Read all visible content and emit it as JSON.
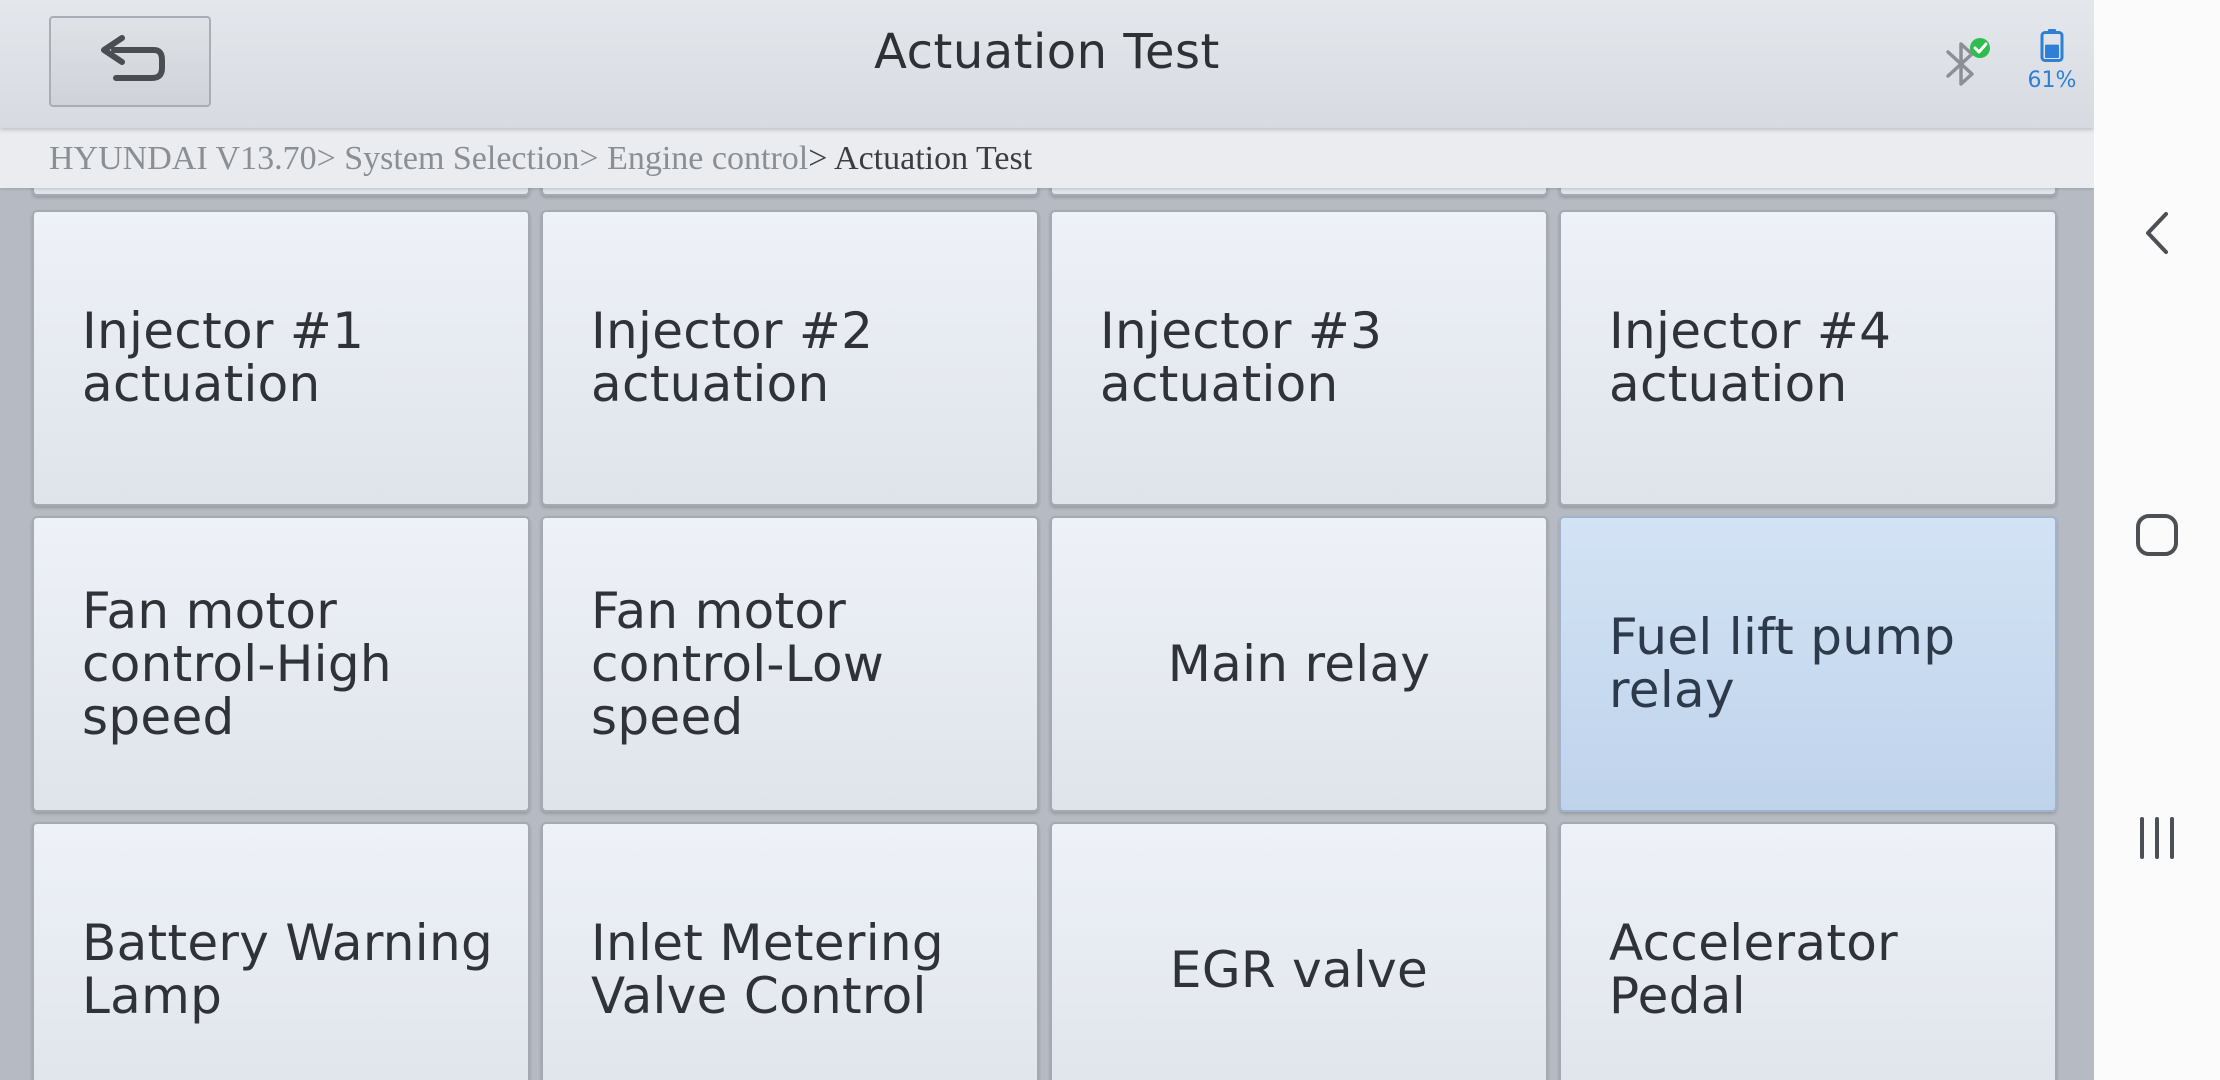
{
  "header": {
    "title": "Actuation Test",
    "back_icon": "back-arrow-icon",
    "bluetooth_icon": "bluetooth-connected-icon",
    "battery_icon": "battery-icon",
    "battery_percent": "61%",
    "battery_level": 0.61,
    "accent_color": "#2f7fd6",
    "connected_color": "#2ebd4e"
  },
  "breadcrumb": {
    "items": [
      "HYUNDAI V13.70",
      "> System Selection",
      "> Engine control",
      "> Actuation Test"
    ]
  },
  "tiles": [
    {
      "label": "Injector #1\nactuation",
      "selected": false,
      "centered": false
    },
    {
      "label": "Injector #2\nactuation",
      "selected": false,
      "centered": false
    },
    {
      "label": "Injector #3\nactuation",
      "selected": false,
      "centered": false
    },
    {
      "label": "Injector #4\nactuation",
      "selected": false,
      "centered": false
    },
    {
      "label": "Fan motor\ncontrol-High\nspeed",
      "selected": false,
      "centered": false
    },
    {
      "label": "Fan motor\ncontrol-Low\nspeed",
      "selected": false,
      "centered": false
    },
    {
      "label": "Main relay",
      "selected": false,
      "centered": true
    },
    {
      "label": "Fuel lift pump\nrelay",
      "selected": true,
      "centered": false
    },
    {
      "label": "Battery Warning\nLamp",
      "selected": false,
      "centered": false
    },
    {
      "label": "Inlet Metering\nValve Control",
      "selected": false,
      "centered": false
    },
    {
      "label": "EGR valve",
      "selected": false,
      "centered": true
    },
    {
      "label": "Accelerator\nPedal",
      "selected": false,
      "centered": false
    }
  ],
  "system_nav": {
    "back_icon": "nav-back-icon",
    "home_icon": "nav-home-icon",
    "recents_icon": "nav-recents-icon"
  }
}
